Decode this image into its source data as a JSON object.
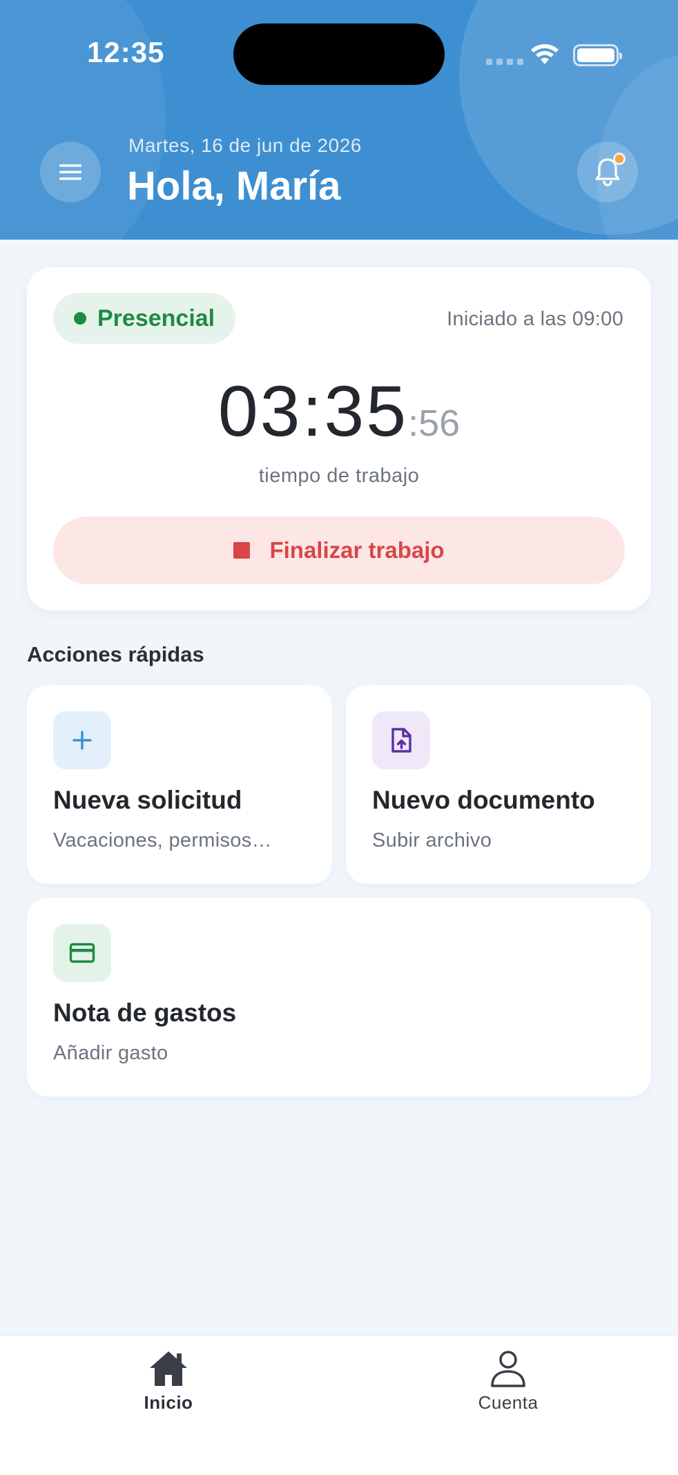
{
  "status_bar": {
    "time": "12:35"
  },
  "header": {
    "date": "Martes, 16 de jun de 2026",
    "greeting": "Hola, María",
    "menu_icon": "hamburger-menu-icon",
    "notification_icon": "bell-icon",
    "has_unread_notifications": true,
    "background_color": "#3d8fd1"
  },
  "timer_card": {
    "mode": "Presencial",
    "mode_color": "#1f8a42",
    "started_text": "Iniciado a las 09:00",
    "time_main": "03:35",
    "time_seconds": ":56",
    "caption": "tiempo de trabajo",
    "finish_label": "Finalizar trabajo",
    "finish_color": "#d94646"
  },
  "quick_actions": {
    "title": "Acciones rápidas",
    "items": [
      {
        "title": "Nueva solicitud",
        "subtitle": "Vacaciones, permisos…",
        "icon": "plus-icon",
        "accent": "#3d8fd1"
      },
      {
        "title": "Nuevo documento",
        "subtitle": "Subir archivo",
        "icon": "file-upload-icon",
        "accent": "#5b2fa8"
      },
      {
        "title": "Nota de gastos",
        "subtitle": "Añadir gasto",
        "icon": "credit-card-icon",
        "accent": "#1f8a42"
      }
    ]
  },
  "bottom_nav": {
    "tabs": [
      {
        "label": "Inicio",
        "icon": "home-icon",
        "active": true
      },
      {
        "label": "Cuenta",
        "icon": "user-icon",
        "active": false
      }
    ]
  }
}
